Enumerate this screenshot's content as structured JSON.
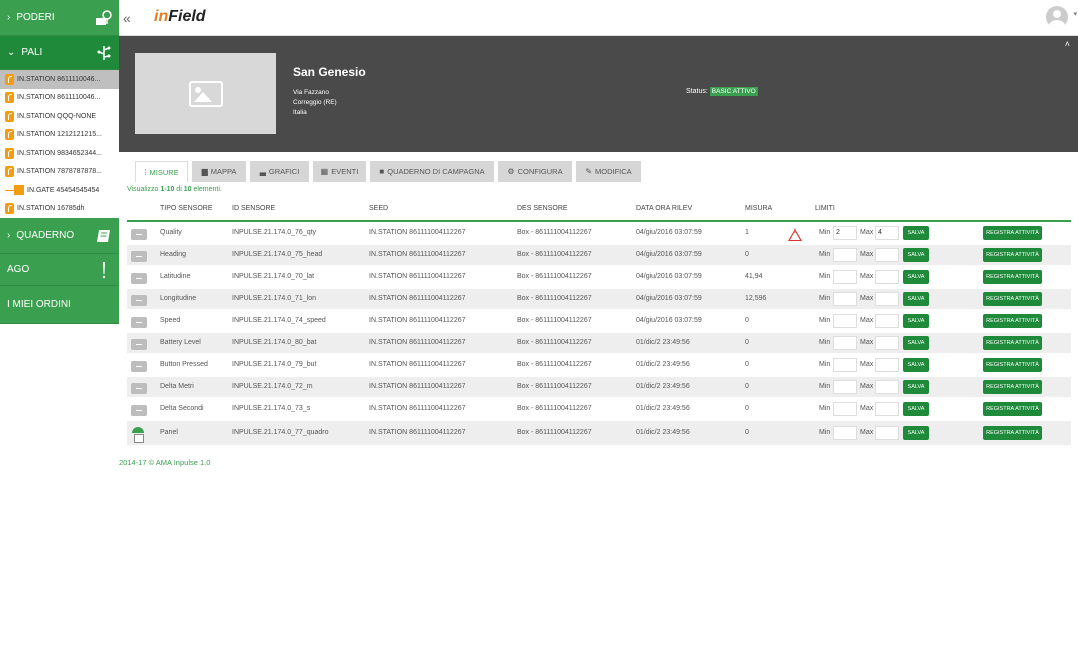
{
  "sidebar": {
    "poderi": "PODERI",
    "pali": "PALI",
    "stations": [
      "IN.STATION 8611110046...",
      "IN.STATION 8611110046...",
      "IN.STATION QQQ-NONE",
      "IN.STATION 1212121215...",
      "IN.STATION 9834652344...",
      "IN.STATION 7878787878...",
      "IN.GATE 45454545454",
      "IN.STATION 16785dh"
    ],
    "quaderno": "QUADERNO",
    "ago": "AGO",
    "ordini": "I MIEI ORDINI"
  },
  "topbar": {
    "collapse": "«",
    "logo_in": "in",
    "logo_field": "Field"
  },
  "site": {
    "name": "San Genesio",
    "address1": "Via Fazzano",
    "address2": "Correggio (RE)",
    "address3": "Italia",
    "status_label": "Status:",
    "status_value": "BASIC ATTIVO"
  },
  "tabs": [
    {
      "icon": "⁞",
      "label": "MISURE"
    },
    {
      "icon": "▆",
      "label": "MAPPA"
    },
    {
      "icon": "▃",
      "label": "GRAFICI"
    },
    {
      "icon": "▦",
      "label": "EVENTI"
    },
    {
      "icon": "■",
      "label": "QUADERNO DI CAMPAGNA"
    },
    {
      "icon": "⚙",
      "label": "CONFIGURA"
    },
    {
      "icon": "✎",
      "label": "MODIFICA"
    }
  ],
  "count": {
    "prefix": "Visualizzo ",
    "range": "1-10",
    "mid": " di ",
    "total": "10",
    "suffix": " elementi."
  },
  "columns": {
    "tipo": "TIPO SENSORE",
    "id": "ID SENSORE",
    "seed": "SEED",
    "des": "DES SENSORE",
    "data": "DATA ORA RILEV",
    "misura": "MISURA",
    "limiti": "LIMITI"
  },
  "labels": {
    "min": "Min",
    "max": "Max",
    "salva": "SALVA",
    "registra": "REGISTRA ATTIVITÀ"
  },
  "rows": [
    {
      "tipo": "Quality",
      "id": "INPULSE.21.174.0_76_qty",
      "seed": "IN.STATION 861111004112267",
      "des": "Box - 861111004112267",
      "data": "04/giu/2016 03:07:59",
      "misura": "1",
      "min": "2",
      "max": "4"
    },
    {
      "tipo": "Heading",
      "id": "INPULSE.21.174.0_75_head",
      "seed": "IN.STATION 861111004112267",
      "des": "Box - 861111004112267",
      "data": "04/giu/2016 03:07:59",
      "misura": "0",
      "min": "",
      "max": ""
    },
    {
      "tipo": "Latitudine",
      "id": "INPULSE.21.174.0_70_lat",
      "seed": "IN.STATION 861111004112267",
      "des": "Box - 861111004112267",
      "data": "04/giu/2016 03:07:59",
      "misura": "41,94",
      "min": "",
      "max": ""
    },
    {
      "tipo": "Longitudine",
      "id": "INPULSE.21.174.0_71_lon",
      "seed": "IN.STATION 861111004112267",
      "des": "Box - 861111004112267",
      "data": "04/giu/2016 03:07:59",
      "misura": "12,596",
      "min": "",
      "max": ""
    },
    {
      "tipo": "Speed",
      "id": "INPULSE.21.174.0_74_speed",
      "seed": "IN.STATION 861111004112267",
      "des": "Box - 861111004112267",
      "data": "04/giu/2016 03:07:59",
      "misura": "0",
      "min": "",
      "max": ""
    },
    {
      "tipo": "Battery Level",
      "id": "INPULSE.21.174.0_80_bat",
      "seed": "IN.STATION 861111004112267",
      "des": "Box - 861111004112267",
      "data": "01/dic/2 23:49:56",
      "misura": "0",
      "min": "",
      "max": ""
    },
    {
      "tipo": "Button Pressed",
      "id": "INPULSE.21.174.0_79_but",
      "seed": "IN.STATION 861111004112267",
      "des": "Box - 861111004112267",
      "data": "01/dic/2 23:49:56",
      "misura": "0",
      "min": "",
      "max": ""
    },
    {
      "tipo": "Delta Metri",
      "id": "INPULSE.21.174.0_72_m",
      "seed": "IN.STATION 861111004112267",
      "des": "Box - 861111004112267",
      "data": "01/dic/2 23:49:56",
      "misura": "0",
      "min": "",
      "max": ""
    },
    {
      "tipo": "Delta Secondi",
      "id": "INPULSE.21.174.0_73_s",
      "seed": "IN.STATION 861111004112267",
      "des": "Box - 861111004112267",
      "data": "01/dic/2 23:49:56",
      "misura": "0",
      "min": "",
      "max": ""
    },
    {
      "tipo": "Panel",
      "id": "INPULSE.21.174.0_77_quadro",
      "seed": "IN.STATION 861111004112267",
      "des": "Box - 861111004112267",
      "data": "01/dic/2 23:49:56",
      "misura": "0",
      "min": "",
      "max": ""
    }
  ],
  "footer": "2014-17 © AMA Inpulse 1.0",
  "colors": {
    "green": "#3aa050",
    "dark_green": "#1e8a3a",
    "orange": "#f39c12",
    "banner": "#4a4a4a"
  }
}
